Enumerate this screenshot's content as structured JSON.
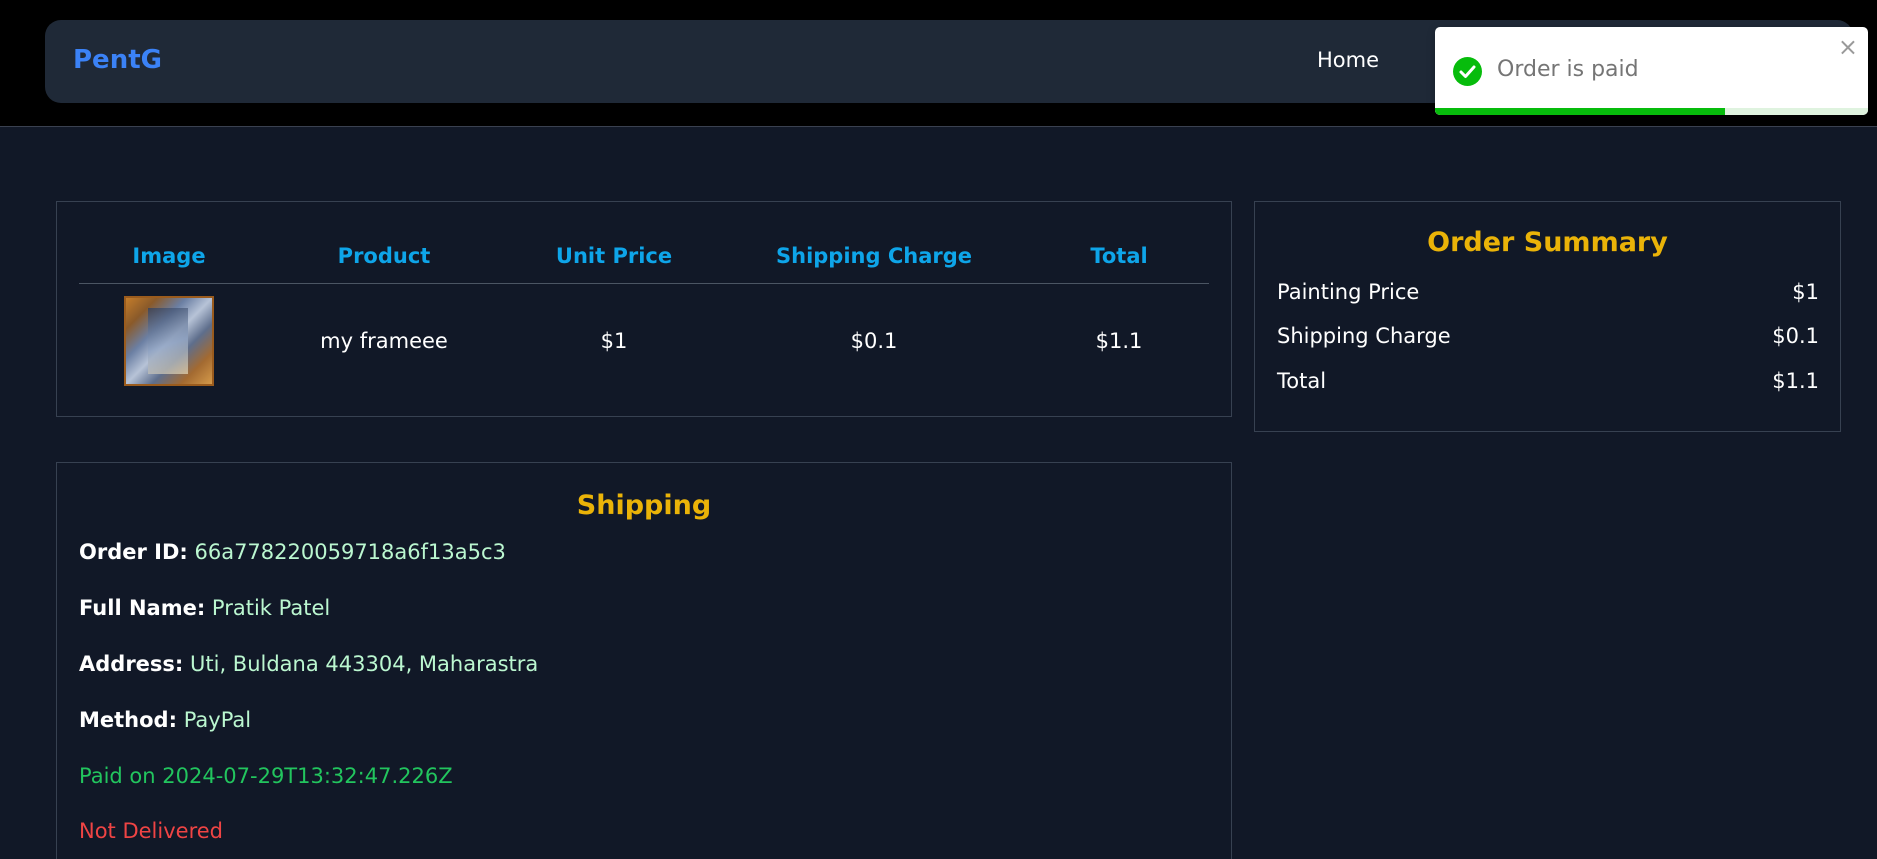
{
  "nav": {
    "brand": "PentG",
    "home": "Home"
  },
  "toast": {
    "message": "Order is paid",
    "close": "×",
    "progress": 0.67,
    "status_color": "#07bc0c",
    "icon": "check-circle-icon"
  },
  "items_table": {
    "headers": [
      "Image",
      "Product",
      "Unit Price",
      "Shipping Charge",
      "Total"
    ],
    "rows": [
      {
        "image": "painting-thumbnail",
        "product": "my frameee",
        "unit_price": "$1",
        "shipping_charge": "$0.1",
        "total": "$1.1"
      }
    ]
  },
  "summary": {
    "title": "Order Summary",
    "rows": [
      {
        "label": "Painting Price",
        "value": "$1"
      },
      {
        "label": "Shipping Charge",
        "value": "$0.1"
      },
      {
        "label": "Total",
        "value": "$1.1"
      }
    ]
  },
  "shipping": {
    "title": "Shipping",
    "order_id_label": "Order ID:",
    "order_id": "66a778220059718a6f13a5c3",
    "full_name_label": "Full Name:",
    "full_name": "Pratik Patel",
    "address_label": "Address:",
    "address": "Uti, Buldana 443304, Maharastra",
    "method_label": "Method:",
    "method": "PayPal",
    "paid_status": "Paid on 2024-07-29T13:32:47.226Z",
    "delivery_status": "Not Delivered"
  },
  "colors": {
    "accent_heading": "#eab308",
    "table_header": "#0ea5e9",
    "brand": "#3b82f6",
    "value_text": "#bbf7d0",
    "paid": "#22c55e",
    "not_delivered": "#ef4444"
  }
}
